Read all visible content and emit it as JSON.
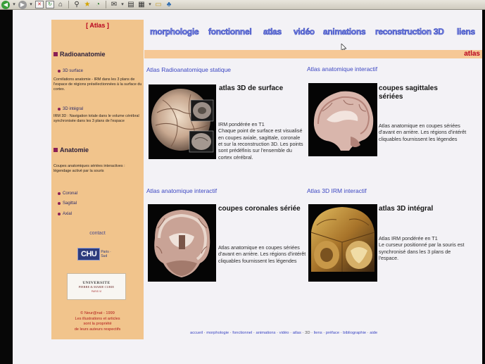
{
  "browser": {
    "toolbar_icons": [
      "back-icon",
      "forward-icon",
      "stop-icon",
      "refresh-icon",
      "home-icon",
      "search-icon",
      "favorites-icon",
      "history-icon",
      "mail-icon",
      "print-icon",
      "edit-icon",
      "folder-icon",
      "messenger-icon"
    ],
    "back_glyph": "◀",
    "forward_glyph": "▶",
    "dropdown_glyph": "▾"
  },
  "sidebar": {
    "title": "[ Atlas ]",
    "section1": {
      "heading": "Radioanatomie",
      "link1": "3D surface",
      "desc1": "Corrélations anatomie - IRM dans les 3 plans de l'espace de régions présélectionnées à la surface du cortex.",
      "link2": "3D intégral",
      "desc2": "IRM 3D : Navigation totale dans le volume cérébral synchronisée dans les 3 plans de l'espace"
    },
    "section2": {
      "heading": "Anatomie",
      "desc": "Coupes anatomiques sériées interactives : légendage activé par la souris",
      "links": [
        "Coronal",
        "Sagittal",
        "Axial"
      ]
    },
    "contact": "contact",
    "chu_logo": "CHU",
    "chu_sub": "Paris · Sud",
    "univ_line1": "UNIVERSITE",
    "univ_line2": "PIERRE & MARIE CURIE",
    "univ_line3": "PARIS VI",
    "copyright_lines": [
      "© Neur@nat - 1999",
      "Les illustrations et articles",
      "sont la propriété",
      "de leurs auteurs respectifs"
    ]
  },
  "topnav": [
    {
      "label": "morphologie"
    },
    {
      "label": "fonctionnel"
    },
    {
      "label": "atlas"
    },
    {
      "label": "vidéo"
    },
    {
      "label": "animations"
    },
    {
      "label": "reconstruction 3D"
    },
    {
      "label": "liens"
    }
  ],
  "atlas_bar": "atlas",
  "cards": [
    {
      "category": "Atlas Radioanatomique statique",
      "title": "atlas 3D de surface",
      "desc": "IRM pondérée en T1\nChaque point de surface est visualisé en coupes axiale, sagittale, coronale et sur la reconstruction 3D. Les points sont prédéfinis sur l'ensemble du cortex cérébral."
    },
    {
      "category": "Atlas anatomique interactif",
      "title": "coupes sagittales sériées",
      "desc": "Atlas anatomique en coupes sériées d'avant en arrière. Les régions d'intérêt cliquables fournissent les légendes"
    },
    {
      "category": "Atlas anatomique interactif",
      "title": "coupes coronales sériée",
      "desc": "Atlas anatomique en coupes sériées d'avant en arrière. Les régions d'intérêt cliquables fournissent les légendes"
    },
    {
      "category": "Atlas 3D IRM interactif",
      "title": "atlas 3D intégral",
      "desc": "Atlas IRM pondérée en T1\nLe curseur positionné par la souris est synchronisé dans les 3 plans de l'espace."
    }
  ],
  "footer": [
    {
      "label": "accueil",
      "link": true
    },
    {
      "label": "morphologie",
      "link": true
    },
    {
      "label": "fonctionnel",
      "link": true
    },
    {
      "label": "animations",
      "link": true
    },
    {
      "label": "vidéo",
      "link": true
    },
    {
      "label": "atlas",
      "link": true
    },
    {
      "label": "3D",
      "link": false
    },
    {
      "label": "liens",
      "link": true
    },
    {
      "label": "préface",
      "link": true
    },
    {
      "label": "bibliographie",
      "link": true
    },
    {
      "label": "aide",
      "link": true
    }
  ],
  "colors": {
    "sidebar_bg": "#f1c48c",
    "accent_red": "#b8001c",
    "link_blue": "#3b46c2",
    "nav_blue": "#7f8be8",
    "bullet": "#8a1f56"
  }
}
